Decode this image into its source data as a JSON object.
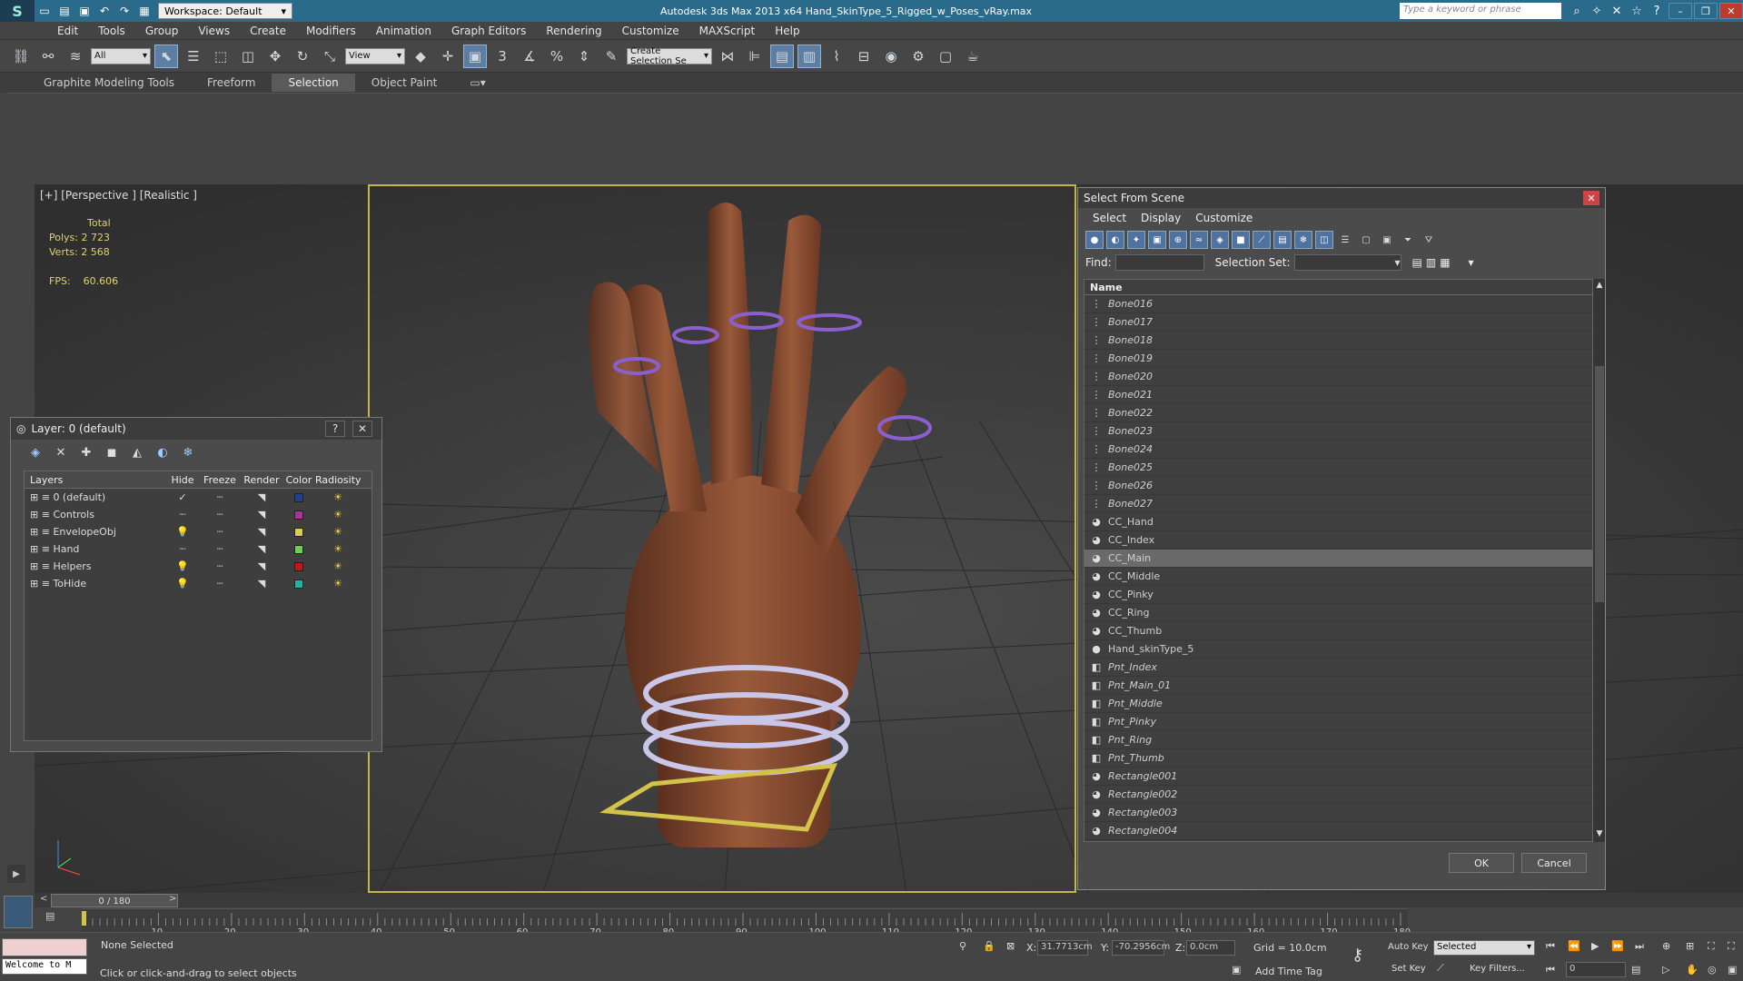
{
  "app": {
    "title": "Autodesk 3ds Max  2013 x64      Hand_SkinType_5_Rigged_w_Poses_vRay.max",
    "workspace": "Workspace: Default",
    "search_placeholder": "Type a keyword or phrase"
  },
  "menu": [
    "Edit",
    "Tools",
    "Group",
    "Views",
    "Create",
    "Modifiers",
    "Animation",
    "Graph Editors",
    "Rendering",
    "Customize",
    "MAXScript",
    "Help"
  ],
  "toolbar": {
    "filter": "All",
    "refcoord": "View",
    "selection_set": "Create Selection Se"
  },
  "ribbon": {
    "tabs": [
      "Graphite Modeling Tools",
      "Freeform",
      "Selection",
      "Object Paint"
    ],
    "active": "Selection"
  },
  "viewport": {
    "label": "[+] [Perspective ] [Realistic ]",
    "stats": {
      "header": "Total",
      "polys_label": "Polys:",
      "polys": "2 723",
      "verts_label": "Verts:",
      "verts": "2 568",
      "fps_label": "FPS:",
      "fps": "60.606"
    }
  },
  "layer_dialog": {
    "title": "Layer: 0 (default)",
    "help": "?",
    "close": "✕",
    "columns": [
      "Layers",
      "Hide",
      "Freeze",
      "Render",
      "Color",
      "Radiosity"
    ],
    "rows": [
      {
        "name": "0 (default)",
        "color": "#1f3f8f"
      },
      {
        "name": "Controls",
        "color": "#b0309a"
      },
      {
        "name": "EnvelopeObj",
        "color": "#d9cc50"
      },
      {
        "name": "Hand",
        "color": "#6ad050"
      },
      {
        "name": "Helpers",
        "color": "#c01818"
      },
      {
        "name": "ToHide",
        "color": "#20b4a0"
      }
    ]
  },
  "select_from_scene": {
    "title": "Select From Scene",
    "menu": [
      "Select",
      "Display",
      "Customize"
    ],
    "find_label": "Find:",
    "selection_set_label": "Selection Set:",
    "column_name": "Name",
    "items": [
      {
        "name": "Bone016",
        "type": "bone"
      },
      {
        "name": "Bone017",
        "type": "bone"
      },
      {
        "name": "Bone018",
        "type": "bone"
      },
      {
        "name": "Bone019",
        "type": "bone"
      },
      {
        "name": "Bone020",
        "type": "bone"
      },
      {
        "name": "Bone021",
        "type": "bone"
      },
      {
        "name": "Bone022",
        "type": "bone"
      },
      {
        "name": "Bone023",
        "type": "bone"
      },
      {
        "name": "Bone024",
        "type": "bone"
      },
      {
        "name": "Bone025",
        "type": "bone"
      },
      {
        "name": "Bone026",
        "type": "bone"
      },
      {
        "name": "Bone027",
        "type": "bone"
      },
      {
        "name": "CC_Hand",
        "type": "shape"
      },
      {
        "name": "CC_Index",
        "type": "shape"
      },
      {
        "name": "CC_Main",
        "type": "shape",
        "selected": true
      },
      {
        "name": "CC_Middle",
        "type": "shape"
      },
      {
        "name": "CC_Pinky",
        "type": "shape"
      },
      {
        "name": "CC_Ring",
        "type": "shape"
      },
      {
        "name": "CC_Thumb",
        "type": "shape"
      },
      {
        "name": "Hand_skinType_5",
        "type": "geometry"
      },
      {
        "name": "Pnt_Index",
        "type": "helper"
      },
      {
        "name": "Pnt_Main_01",
        "type": "helper"
      },
      {
        "name": "Pnt_Middle",
        "type": "helper"
      },
      {
        "name": "Pnt_Pinky",
        "type": "helper"
      },
      {
        "name": "Pnt_Ring",
        "type": "helper"
      },
      {
        "name": "Pnt_Thumb",
        "type": "helper"
      },
      {
        "name": "Rectangle001",
        "type": "shape-it"
      },
      {
        "name": "Rectangle002",
        "type": "shape-it"
      },
      {
        "name": "Rectangle003",
        "type": "shape-it"
      },
      {
        "name": "Rectangle004",
        "type": "shape-it"
      }
    ],
    "ok": "OK",
    "cancel": "Cancel"
  },
  "timeline": {
    "frame": "0 / 180",
    "ticks": [
      "10",
      "20",
      "30",
      "40",
      "50",
      "60",
      "70",
      "80",
      "90",
      "100",
      "110",
      "120",
      "130",
      "140",
      "150",
      "160",
      "170",
      "180"
    ]
  },
  "status": {
    "maxscript": "Welcome to M",
    "selection": "None Selected",
    "prompt": "Click or click-and-drag to select objects",
    "x_label": "X:",
    "x": "31.7713cm",
    "y_label": "Y:",
    "y": "-70.2956cm",
    "z_label": "Z:",
    "z": "0.0cm",
    "grid": "Grid = 10.0cm",
    "add_time_tag": "Add Time Tag",
    "auto_key": "Auto Key",
    "auto_key_mode": "Selected",
    "set_key": "Set Key",
    "key_filters": "Key Filters...",
    "current_frame": "0"
  }
}
